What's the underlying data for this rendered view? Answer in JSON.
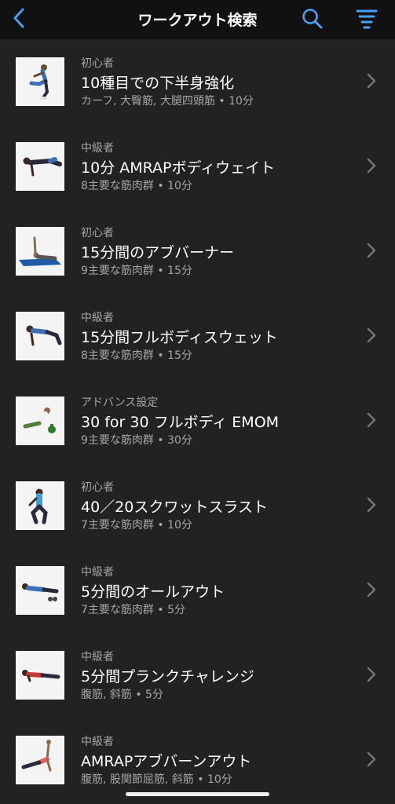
{
  "header": {
    "title": "ワークアウト検索",
    "accent": "#4a9ff5"
  },
  "workouts": [
    {
      "level": "初心者",
      "name": "10種目での下半身強化",
      "meta": "カーフ, 大臀筋, 大腿四頭筋 • 10分"
    },
    {
      "level": "中級者",
      "name": "10分 AMRAPボディウェイト",
      "meta": "8主要な筋肉群 • 10分"
    },
    {
      "level": "初心者",
      "name": "15分間のアブバーナー",
      "meta": "9主要な筋肉群 • 15分"
    },
    {
      "level": "中級者",
      "name": "15分間フルボディスウェット",
      "meta": "8主要な筋肉群 • 15分"
    },
    {
      "level": "アドバンス設定",
      "name": "30 for 30 フルボディ EMOM",
      "meta": "9主要な筋肉群 • 30分"
    },
    {
      "level": "初心者",
      "name": "40／20スクワットスラスト",
      "meta": "7主要な筋肉群 • 10分"
    },
    {
      "level": "中級者",
      "name": "5分間のオールアウト",
      "meta": "7主要な筋肉群 • 5分"
    },
    {
      "level": "中級者",
      "name": "5分間プランクチャレンジ",
      "meta": "腹筋, 斜筋 • 5分"
    },
    {
      "level": "中級者",
      "name": "AMRAPアブバーンアウト",
      "meta": "腹筋, 股関節屈筋, 斜筋 • 10分"
    }
  ]
}
